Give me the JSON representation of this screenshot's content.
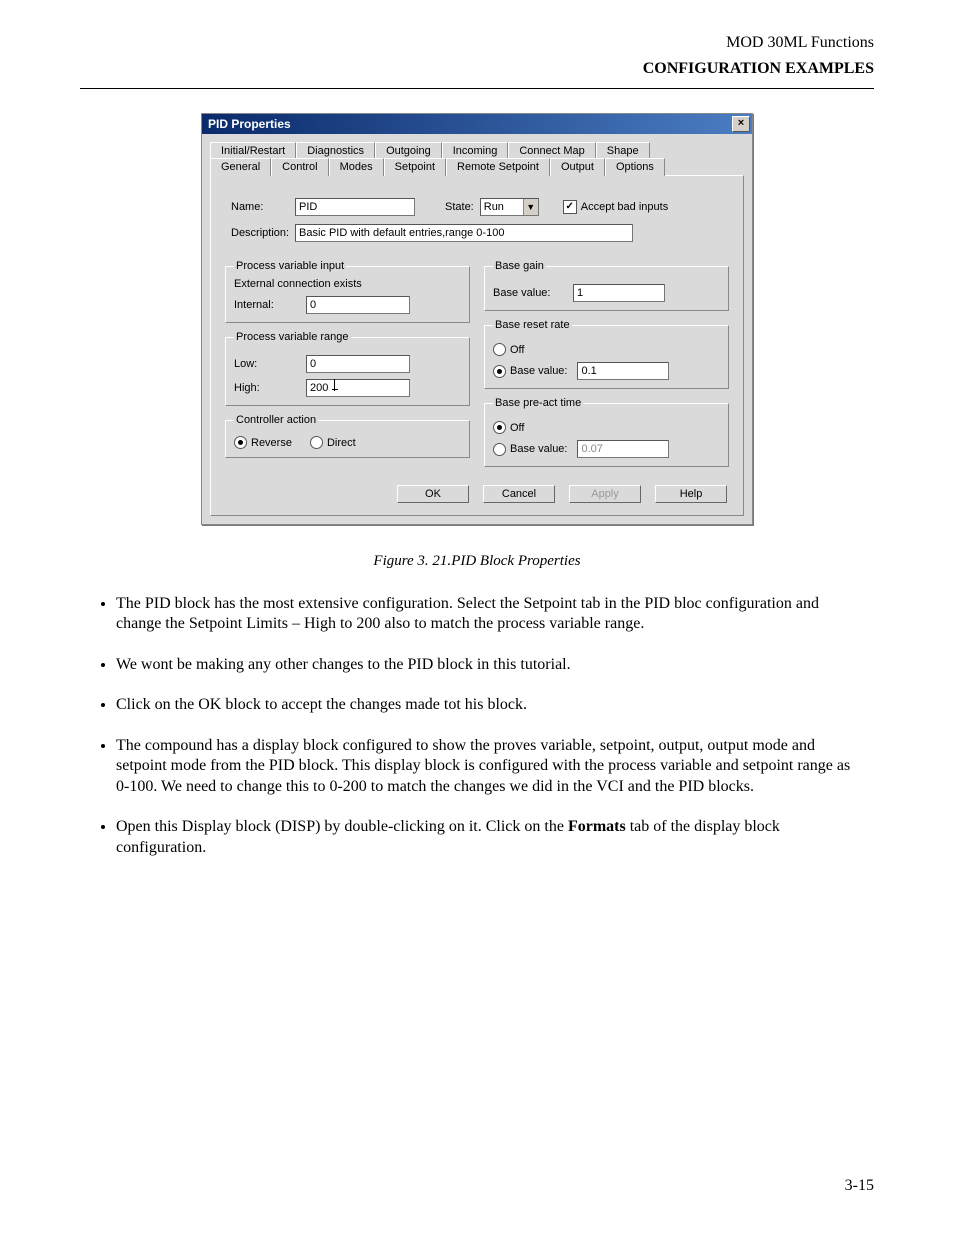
{
  "header": {
    "line1": "MOD 30ML Functions",
    "line2": "CONFIGURATION EXAMPLES"
  },
  "dialog": {
    "title": "PID Properties",
    "close_glyph": "×",
    "tabs_back": [
      "Initial/Restart",
      "Diagnostics",
      "Outgoing",
      "Incoming",
      "Connect Map",
      "Shape"
    ],
    "tabs_front": [
      "General",
      "Control",
      "Modes",
      "Setpoint",
      "Remote Setpoint",
      "Output",
      "Options"
    ],
    "general": {
      "name_label": "Name:",
      "name_value": "PID",
      "state_label": "State:",
      "state_value": "Run",
      "accept_label": "Accept bad inputs",
      "desc_label": "Description:",
      "desc_value": "Basic PID with default entries,range 0-100"
    },
    "pvi": {
      "legend": "Process variable input",
      "ext_label": "External connection exists",
      "internal_label": "Internal:",
      "internal_value": "0"
    },
    "pvr": {
      "legend": "Process variable range",
      "low_label": "Low:",
      "low_value": "0",
      "high_label": "High:",
      "high_value": "200"
    },
    "ctrl": {
      "legend": "Controller action",
      "reverse": "Reverse",
      "direct": "Direct"
    },
    "bg": {
      "legend": "Base gain",
      "bv_label": "Base value:",
      "bv_value": "1"
    },
    "brr": {
      "legend": "Base reset rate",
      "off": "Off",
      "bv_label": "Base value:",
      "bv_value": "0.1"
    },
    "bpa": {
      "legend": "Base pre-act time",
      "off": "Off",
      "bv_label": "Base value:",
      "bv_value": "0.07"
    },
    "buttons": {
      "ok": "OK",
      "cancel": "Cancel",
      "apply": "Apply",
      "help": "Help"
    }
  },
  "caption": {
    "fig": "Figure 3. 21.",
    "title": "PID Block Properties"
  },
  "bullets": {
    "b1": "The PID block has the most extensive configuration. Select the Setpoint tab in the PID bloc configuration and change the Setpoint Limits – High to 200 also to match the process variable range.",
    "b2": "We wont be making any other changes to the PID block in this tutorial.",
    "b3": "Click on the OK block to accept the changes made tot his block.",
    "b4": "The compound has a display block configured to show the proves variable, setpoint, output, output mode and setpoint mode from the PID block. This display block is configured with the process variable and setpoint range as 0-100. We need to change this to 0-200 to match the changes we did in the VCI and the PID blocks.",
    "b5a": "Open this Display block (DISP) by double-clicking on it. Click on the ",
    "b5bold": "Formats",
    "b5b": " tab of the display block configuration."
  },
  "page_number": "3-15"
}
